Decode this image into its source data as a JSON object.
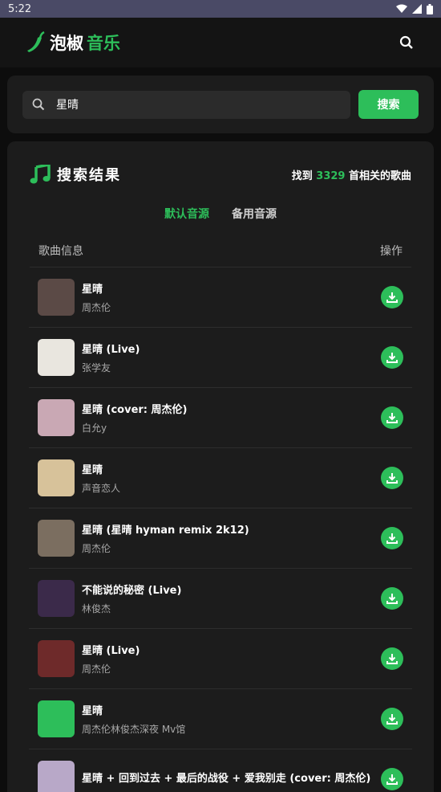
{
  "status_bar": {
    "time": "5:22"
  },
  "app": {
    "title_main": "泡椒",
    "title_accent": "音乐"
  },
  "search": {
    "value": "星晴",
    "placeholder": "",
    "button_label": "搜索"
  },
  "results": {
    "title": "搜索结果",
    "count_prefix": "找到 ",
    "count": "3329",
    "count_suffix": " 首相关的歌曲",
    "tabs": [
      {
        "label": "默认音源",
        "active": true
      },
      {
        "label": "备用音源",
        "active": false
      }
    ],
    "col_info": "歌曲信息",
    "col_action": "操作",
    "songs": [
      {
        "title": "星晴",
        "artist": "周杰伦",
        "cover": "#5b4a46"
      },
      {
        "title": "星晴 (Live)",
        "artist": "张学友",
        "cover": "#e9e6df"
      },
      {
        "title": "星晴 (cover: 周杰伦)",
        "artist": "白允y",
        "cover": "#c9a8b4"
      },
      {
        "title": "星晴",
        "artist": "声音恋人",
        "cover": "#d7c29a"
      },
      {
        "title": "星晴 (星晴 hyman remix 2k12)",
        "artist": "周杰伦",
        "cover": "#7b6e60"
      },
      {
        "title": "不能说的秘密 (Live)",
        "artist": "林俊杰",
        "cover": "#3b2a4a"
      },
      {
        "title": "星晴 (Live)",
        "artist": "周杰伦",
        "cover": "#6e2a2a"
      },
      {
        "title": "星晴",
        "artist": "周杰伦林俊杰深夜 Mv馆",
        "cover": "#2dbe5a"
      },
      {
        "title": "星晴 + 回到过去 + 最后的战役 + 爱我别走 (cover: 周杰伦)",
        "artist": "",
        "cover": "#b8a8c8"
      }
    ]
  },
  "colors": {
    "accent": "#2dbe5a",
    "background": "#0d0d0d",
    "card": "#1c1c1c"
  },
  "icons": [
    "pepper-icon",
    "search-icon",
    "music-note-icon",
    "download-icon",
    "wifi-icon",
    "signal-icon",
    "battery-icon"
  ]
}
